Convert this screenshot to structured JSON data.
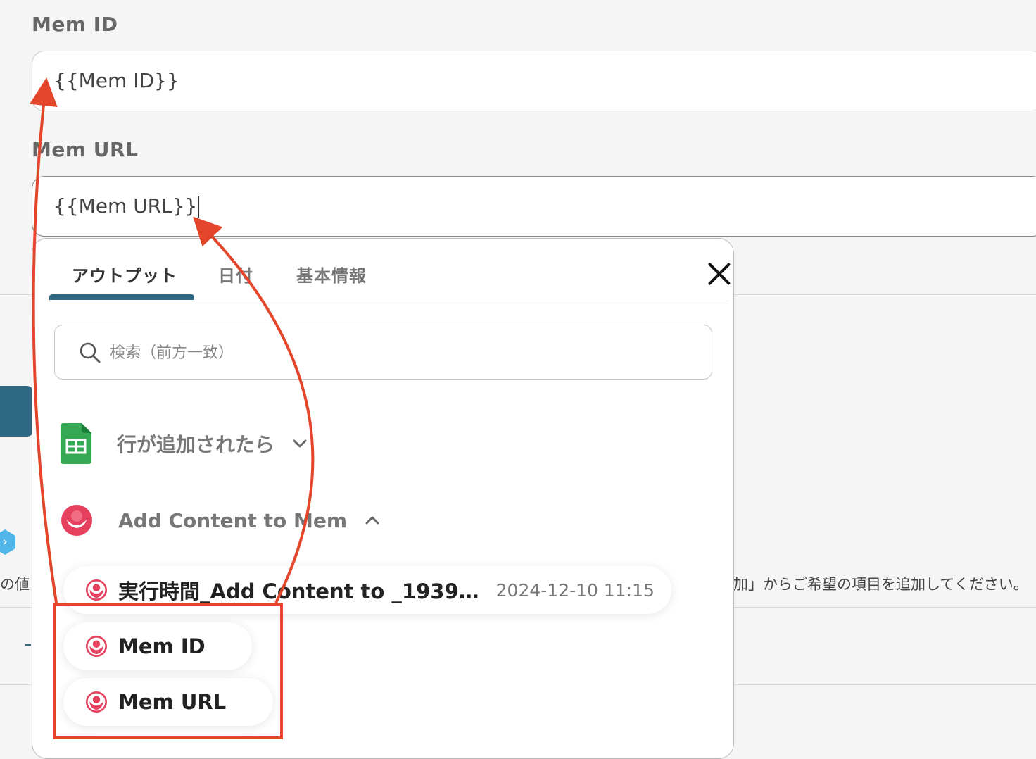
{
  "fields": [
    {
      "label": "Mem ID",
      "value": "{{Mem ID}}"
    },
    {
      "label": "Mem URL",
      "value": "{{Mem URL}}"
    }
  ],
  "background": {
    "left_text": "の値",
    "right_text": "加」からご希望の項目を追加してください。"
  },
  "picker": {
    "tabs": [
      {
        "label": "アウトプット",
        "active": true
      },
      {
        "label": "日付",
        "active": false
      },
      {
        "label": "基本情報",
        "active": false
      }
    ],
    "search_placeholder": "検索（前方一致）",
    "sections": [
      {
        "title": "行が追加されたら",
        "icon": "google-sheets-icon",
        "expanded": false
      },
      {
        "title": "Add Content to Mem",
        "icon": "mem-logo-icon",
        "expanded": true
      }
    ],
    "items": [
      {
        "label": "実行時間_Add Content to _1939…",
        "meta": "2024-12-10 11:15"
      },
      {
        "label": "Mem ID",
        "meta": ""
      },
      {
        "label": "Mem URL",
        "meta": ""
      }
    ]
  },
  "colors": {
    "accent": "#2f6883",
    "annotation": "#e4462c",
    "mem_brand": "#e5405e",
    "sheets_green": "#34a853"
  }
}
